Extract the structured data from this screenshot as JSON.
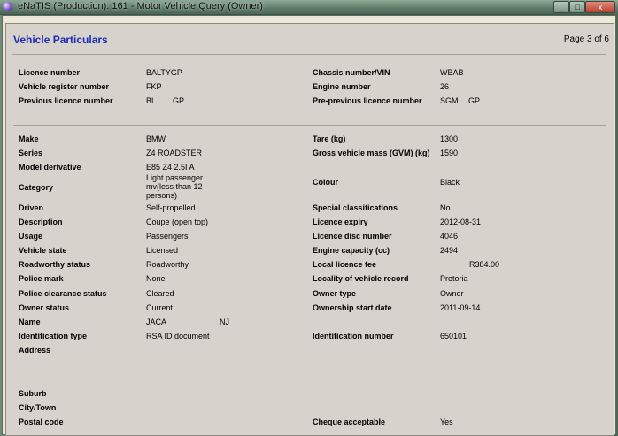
{
  "window": {
    "title": "eNaTIS (Production): 161 - Motor Vehicle Query (Owner)",
    "minimize_glyph": "_",
    "maximize_glyph": "□",
    "close_glyph": "x"
  },
  "header": {
    "title": "Vehicle Particulars",
    "page": "Page 3 of 6"
  },
  "registration": {
    "licence_number_label": "Licence number",
    "licence_number": "BALTYGP",
    "chassis_label": "Chassis number/VIN",
    "chassis": "WBAB",
    "vehicle_register_label": "Vehicle register number",
    "vehicle_register": "FKP",
    "engine_number_label": "Engine number",
    "engine_number": "26",
    "previous_licence_label": "Previous licence number",
    "previous_licence_a": "BL",
    "previous_licence_b": "GP",
    "pre_previous_label": "Pre-previous licence number",
    "pre_previous_a": "SGM",
    "pre_previous_b": "GP"
  },
  "details": {
    "make_label": "Make",
    "make": "BMW",
    "series_label": "Series",
    "series": "Z4 ROADSTER",
    "model_label": "Model derivative",
    "model": "E85 Z4 2.5I A",
    "category_label": "Category",
    "category": "Light passenger mv(less than 12 persons)",
    "driven_label": "Driven",
    "driven": "Self-propelled",
    "description_label": "Description",
    "description": "Coupe (open top)",
    "usage_label": "Usage",
    "usage": "Passengers",
    "vehicle_state_label": "Vehicle state",
    "vehicle_state": "Licensed",
    "roadworthy_label": "Roadworthy status",
    "roadworthy": "Roadworthy",
    "police_mark_label": "Police mark",
    "police_mark": "None",
    "police_clearance_label": "Police clearance status",
    "police_clearance": "Cleared",
    "owner_status_label": "Owner status",
    "owner_status": "Current",
    "name_label": "Name",
    "name_a": "JACA",
    "name_b": "NJ",
    "id_type_label": "Identification type",
    "id_type": "RSA ID document",
    "address_label": "Address",
    "suburb_label": "Suburb",
    "city_label": "City/Town",
    "postal_label": "Postal code",
    "tare_label": "Tare (kg)",
    "tare": "1300",
    "gvm_label": "Gross vehicle mass (GVM) (kg)",
    "gvm": "1590",
    "colour_label": "Colour",
    "colour": "Black",
    "special_label": "Special classifications",
    "special": "No",
    "licence_expiry_label": "Licence expiry",
    "licence_expiry": "2012-08-31",
    "disc_label": "Licence disc number",
    "disc": "4046",
    "engine_cap_label": "Engine capacity (cc)",
    "engine_cap": "2494",
    "local_fee_label": "Local licence fee",
    "local_fee": "R384.00",
    "locality_label": "Locality of vehicle record",
    "locality": "Pretoria",
    "owner_type_label": "Owner type",
    "owner_type": "Owner",
    "ownership_start_label": "Ownership start date",
    "ownership_start": "2011-09-14",
    "id_number_label": "Identification number",
    "id_number": "650101",
    "cheque_label": "Cheque acceptable",
    "cheque": "Yes"
  }
}
